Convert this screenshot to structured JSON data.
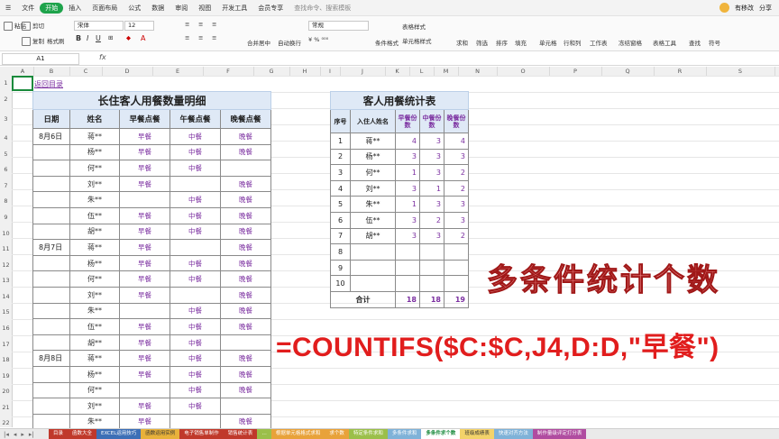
{
  "menu": {
    "items": [
      "文件",
      "开始",
      "插入",
      "页面布局",
      "公式",
      "数据",
      "审阅",
      "视图",
      "开发工具",
      "会员专享"
    ],
    "active_index": 1,
    "search_placeholder": "查找命令、搜索模板",
    "user_label": "有移改",
    "share_label": "分享"
  },
  "ribbon": {
    "cut": "剪切",
    "paste": "粘贴",
    "copy": "复制",
    "format_painter": "格式刷",
    "font_name": "宋体",
    "font_size": "12",
    "merge_center": "合并居中",
    "wrap": "自动换行",
    "number_format": "常规",
    "cond_format": "条件格式",
    "table_style": "表格样式",
    "cell_style": "单元格样式",
    "sum": "求和",
    "filter": "筛选",
    "sort": "排序",
    "fill": "填充",
    "cell": "单元格",
    "row_col": "行和列",
    "worksheet": "工作表",
    "freeze": "冻结窗格",
    "table_tools": "表格工具",
    "find": "查找",
    "symbol": "符号"
  },
  "formula_bar": {
    "cell_ref": "A1",
    "fx": "fx",
    "content": ""
  },
  "columns": [
    "A",
    "B",
    "C",
    "D",
    "E",
    "F",
    "G",
    "H",
    "I",
    "J",
    "K",
    "L",
    "M",
    "N",
    "O",
    "P",
    "Q",
    "R",
    "S"
  ],
  "rows": [
    "1",
    "2",
    "3",
    "4",
    "5",
    "6",
    "7",
    "8",
    "9",
    "10",
    "11",
    "12",
    "13",
    "14",
    "15",
    "16",
    "17",
    "18",
    "19",
    "20",
    "21",
    "22"
  ],
  "back_link": "返回目录",
  "detail_table": {
    "title": "长住客人用餐数量明细",
    "headers": [
      "日期",
      "姓名",
      "早餐点餐",
      "午餐点餐",
      "晚餐点餐"
    ],
    "rows": [
      [
        "8月6日",
        "蒋**",
        "早餐",
        "中餐",
        "晚餐"
      ],
      [
        "",
        "杨**",
        "早餐",
        "中餐",
        "晚餐"
      ],
      [
        "",
        "何**",
        "早餐",
        "中餐",
        ""
      ],
      [
        "",
        "刘**",
        "早餐",
        "",
        "晚餐"
      ],
      [
        "",
        "朱**",
        "",
        "中餐",
        "晚餐"
      ],
      [
        "",
        "伍**",
        "早餐",
        "中餐",
        "晚餐"
      ],
      [
        "",
        "胡**",
        "早餐",
        "中餐",
        "晚餐"
      ],
      [
        "8月7日",
        "蒋**",
        "早餐",
        "",
        "晚餐"
      ],
      [
        "",
        "杨**",
        "早餐",
        "中餐",
        "晚餐"
      ],
      [
        "",
        "何**",
        "早餐",
        "中餐",
        "晚餐"
      ],
      [
        "",
        "刘**",
        "早餐",
        "",
        "晚餐"
      ],
      [
        "",
        "朱**",
        "",
        "中餐",
        "晚餐"
      ],
      [
        "",
        "伍**",
        "早餐",
        "中餐",
        "晚餐"
      ],
      [
        "",
        "胡**",
        "早餐",
        "中餐",
        ""
      ],
      [
        "8月8日",
        "蒋**",
        "早餐",
        "中餐",
        "晚餐"
      ],
      [
        "",
        "杨**",
        "早餐",
        "中餐",
        "晚餐"
      ],
      [
        "",
        "何**",
        "",
        "中餐",
        "晚餐"
      ],
      [
        "",
        "刘**",
        "早餐",
        "中餐",
        ""
      ],
      [
        "",
        "朱**",
        "早餐",
        "",
        "晚餐"
      ]
    ]
  },
  "stats_table": {
    "title": "客人用餐统计表",
    "headers": [
      "序号",
      "入住人姓名",
      "早餐份数",
      "中餐份数",
      "晚餐份数"
    ],
    "rows": [
      [
        "1",
        "蒋**",
        "4",
        "3",
        "4"
      ],
      [
        "2",
        "杨**",
        "3",
        "3",
        "3"
      ],
      [
        "3",
        "何**",
        "1",
        "3",
        "2"
      ],
      [
        "4",
        "刘**",
        "3",
        "1",
        "2"
      ],
      [
        "5",
        "朱**",
        "1",
        "3",
        "3"
      ],
      [
        "6",
        "伍**",
        "3",
        "2",
        "3"
      ],
      [
        "7",
        "胡**",
        "3",
        "3",
        "2"
      ],
      [
        "8",
        "",
        "",
        "",
        ""
      ],
      [
        "9",
        "",
        "",
        "",
        ""
      ],
      [
        "10",
        "",
        "",
        "",
        ""
      ]
    ],
    "total_label": "合计",
    "totals": [
      "18",
      "18",
      "19"
    ]
  },
  "overlay": {
    "heading": "多条件统计个数",
    "formula": "=COUNTIFS($C:$C,J4,D:D,\"早餐\")"
  },
  "sheet_tabs": [
    {
      "label": "目录",
      "color": "#c0392b"
    },
    {
      "label": "函数大全",
      "color": "#c0392b"
    },
    {
      "label": "EXCEL运用技巧",
      "color": "#3d6fb6"
    },
    {
      "label": "函数运用实例",
      "color": "#e8b13a"
    },
    {
      "label": "电子销售单制作",
      "color": "#c0392b"
    },
    {
      "label": "销售统计表",
      "color": "#c0392b"
    },
    {
      "label": "…",
      "color": "#9bbf4a"
    },
    {
      "label": "根据单元格格式求和",
      "color": "#e8a23a"
    },
    {
      "label": "求个数",
      "color": "#e8a23a"
    },
    {
      "label": "特定条件求和",
      "color": "#9bbf4a"
    },
    {
      "label": "多条件求和",
      "color": "#7fb2d8"
    },
    {
      "label": "多条件求个数",
      "color": "#ffffff"
    },
    {
      "label": "班级成绩表",
      "color": "#f3d36a"
    },
    {
      "label": "快速对齐方法",
      "color": "#7fb2d8"
    },
    {
      "label": "制作量级评定打分表",
      "color": "#b04ca0"
    }
  ],
  "active_tab_index": 11
}
